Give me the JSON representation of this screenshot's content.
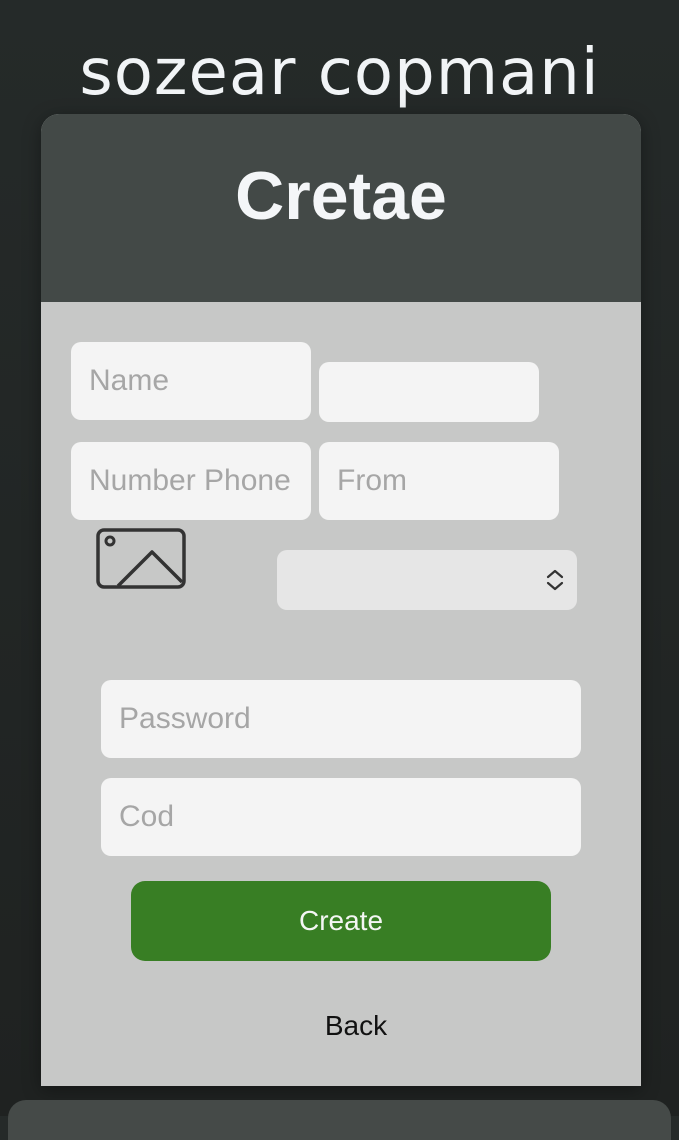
{
  "site": {
    "title": "sozear copmani"
  },
  "form": {
    "title": "Cretae",
    "fields": {
      "name": {
        "placeholder": "Name",
        "value": ""
      },
      "extra": {
        "placeholder": "",
        "value": ""
      },
      "phone": {
        "placeholder": "Number Phone",
        "value": ""
      },
      "from": {
        "placeholder": "From",
        "value": ""
      },
      "password": {
        "placeholder": "Password",
        "value": ""
      },
      "code": {
        "placeholder": "Cod",
        "value": ""
      }
    },
    "select": {
      "selected": ""
    },
    "image_icon": "image-icon",
    "create_label": "Create",
    "back_label": "Back"
  },
  "colors": {
    "background": "#232726",
    "header": "#434947",
    "card_body": "#c7c8c7",
    "accent": "#387e24",
    "field": "#f4f4f4"
  }
}
